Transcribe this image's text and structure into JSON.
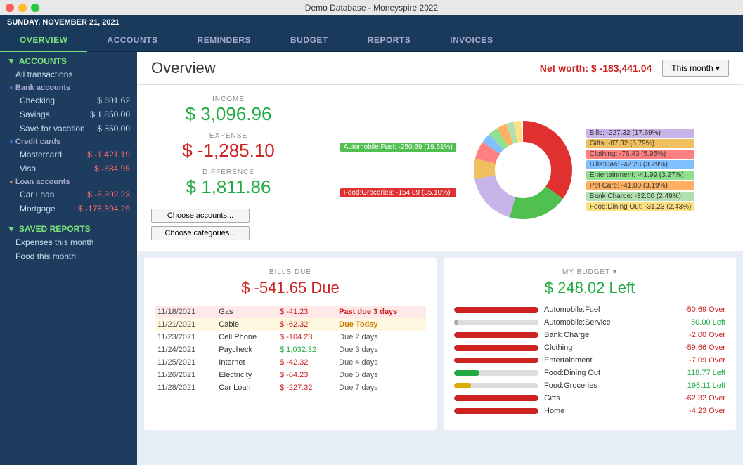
{
  "titlebar": {
    "title": "Demo Database - Moneyspire 2022"
  },
  "datebar": {
    "date": "SUNDAY, NOVEMBER 21, 2021"
  },
  "navtabs": {
    "tabs": [
      {
        "id": "overview",
        "label": "OVERVIEW",
        "active": true
      },
      {
        "id": "accounts",
        "label": "ACCOUNTS",
        "active": false
      },
      {
        "id": "reminders",
        "label": "REMINDERS",
        "active": false
      },
      {
        "id": "budget",
        "label": "BUDGET",
        "active": false
      },
      {
        "id": "reports",
        "label": "REPORTS",
        "active": false
      },
      {
        "id": "invoices",
        "label": "INVOICES",
        "active": false
      }
    ]
  },
  "sidebar": {
    "accounts_label": "ACCOUNTS",
    "all_transactions_label": "All transactions",
    "bank_accounts_label": "Bank accounts",
    "bank_items": [
      {
        "name": "Checking",
        "amount": "$ 601.62",
        "neg": false
      },
      {
        "name": "Savings",
        "amount": "$ 1,850.00",
        "neg": false
      },
      {
        "name": "Save for vacation",
        "amount": "$ 350.00",
        "neg": false
      }
    ],
    "credit_cards_label": "Credit cards",
    "credit_items": [
      {
        "name": "Mastercard",
        "amount": "$ -1,421.19",
        "neg": true
      },
      {
        "name": "Visa",
        "amount": "$ -684.95",
        "neg": true
      }
    ],
    "loan_accounts_label": "Loan accounts",
    "loan_items": [
      {
        "name": "Car Loan",
        "amount": "$ -5,392.23",
        "neg": true
      },
      {
        "name": "Mortgage",
        "amount": "$ -178,394.29",
        "neg": true
      }
    ],
    "saved_reports_label": "SAVED REPORTS",
    "saved_report_items": [
      {
        "name": "Expenses this month"
      },
      {
        "name": "Food this month"
      }
    ]
  },
  "overview": {
    "title": "Overview",
    "net_worth_label": "Net worth: $ -183,441.04",
    "this_month_label": "This month ▾",
    "income_label": "INCOME",
    "income_value": "$ 3,096.96",
    "expense_label": "EXPENSE",
    "expense_value": "$ -1,285.10",
    "difference_label": "DIFFERENCE",
    "difference_value": "$ 1,811.86",
    "choose_accounts_label": "Choose accounts...",
    "choose_categories_label": "Choose categories...",
    "chart_labels": [
      {
        "text": "Bills: -227.32 (17.69%)",
        "color": "#c8b4e8"
      },
      {
        "text": "Gifts: -87.32 (6.79%)",
        "color": "#f0c060"
      },
      {
        "text": "Clothing: -76.43 (5.95%)",
        "color": "#ff8080"
      },
      {
        "text": "Bills:Gas: -42.23 (3.29%)",
        "color": "#80c0ff"
      },
      {
        "text": "Entertainment: -41.99 (3.27%)",
        "color": "#90e090"
      },
      {
        "text": "Pet Care: -41.00 (3.19%)",
        "color": "#ffb060"
      },
      {
        "text": "Bank Charge: -32.00 (2.49%)",
        "color": "#b0e0b0"
      },
      {
        "text": "Food:Dining Out: -31.23 (2.43%)",
        "color": "#ffe080"
      }
    ],
    "pie_segments": [
      {
        "label": "Food:Groceries",
        "value": 35.1,
        "color": "#e03030",
        "startAngle": 0
      },
      {
        "label": "Automobile:Fuel",
        "value": 19.51,
        "color": "#50c050",
        "startAngle": 126.36
      },
      {
        "label": "Bills",
        "value": 17.69,
        "color": "#c8b4e8",
        "startAngle": 196.72
      },
      {
        "label": "Gifts",
        "value": 6.79,
        "color": "#f0c060",
        "startAngle": 260.5
      },
      {
        "label": "Clothing",
        "value": 5.95,
        "color": "#ff8080",
        "startAngle": 284.94
      },
      {
        "label": "Bills:Gas",
        "value": 3.29,
        "color": "#80c0ff",
        "startAngle": 306.36
      },
      {
        "label": "Entertainment",
        "value": 3.27,
        "color": "#90e090",
        "startAngle": 318.2
      },
      {
        "label": "Pet Care",
        "value": 3.19,
        "color": "#ffb060",
        "startAngle": 329.97
      },
      {
        "label": "Bank Charge",
        "value": 2.49,
        "color": "#b0e0b0",
        "startAngle": 341.47
      },
      {
        "label": "Food:Dining Out",
        "value": 2.43,
        "color": "#ffe080",
        "startAngle": 350.42
      }
    ],
    "chart_food_label": "Food:Groceries: -154.89 (35.10%)",
    "chart_auto_label": "Automobile:Fuel: -250.69 (19.51%)"
  },
  "bills": {
    "subtitle": "BILLS DUE",
    "amount": "$ -541.65 Due",
    "rows": [
      {
        "date": "11/18/2021",
        "name": "Gas",
        "amount": "$ -41.23",
        "status": "Past due 3 days",
        "style": "red"
      },
      {
        "date": "11/21/2021",
        "name": "Cable",
        "amount": "$ -62.32",
        "status": "Due Today",
        "style": "yellow"
      },
      {
        "date": "11/23/2021",
        "name": "Cell Phone",
        "amount": "$ -104.23",
        "status": "Due 2 days",
        "style": "normal"
      },
      {
        "date": "11/24/2021",
        "name": "Paycheck",
        "amount": "$ 1,032.32",
        "status": "Due 3 days",
        "style": "normal"
      },
      {
        "date": "11/25/2021",
        "name": "Internet",
        "amount": "$ -42.32",
        "status": "Due 4 days",
        "style": "normal"
      },
      {
        "date": "11/26/2021",
        "name": "Electricity",
        "amount": "$ -64.23",
        "status": "Due 5 days",
        "style": "normal"
      },
      {
        "date": "11/28/2021",
        "name": "Car Loan",
        "amount": "$ -227.32",
        "status": "Due 7 days",
        "style": "normal"
      }
    ]
  },
  "budget": {
    "subtitle": "MY BUDGET ▾",
    "amount": "$ 248.02 Left",
    "rows": [
      {
        "name": "Automobile:Fuel",
        "value": -50.69,
        "label": "-50.69 Over",
        "fill": 100,
        "type": "red"
      },
      {
        "name": "Automobile:Service",
        "value": 50.0,
        "label": "50.00 Left",
        "fill": 5,
        "type": "gray"
      },
      {
        "name": "Bank Charge",
        "value": -2.0,
        "label": "-2.00 Over",
        "fill": 100,
        "type": "red"
      },
      {
        "name": "Clothing",
        "value": -59.66,
        "label": "-59.66 Over",
        "fill": 100,
        "type": "red"
      },
      {
        "name": "Entertainment",
        "value": -7.09,
        "label": "-7.09 Over",
        "fill": 100,
        "type": "red"
      },
      {
        "name": "Food:Dining Out",
        "value": 118.77,
        "label": "118.77 Left",
        "fill": 30,
        "type": "green"
      },
      {
        "name": "Food:Groceries",
        "value": 195.11,
        "label": "195.11 Left",
        "fill": 20,
        "type": "yellow"
      },
      {
        "name": "Gifts",
        "value": -62.32,
        "label": "-62.32 Over",
        "fill": 100,
        "type": "red"
      },
      {
        "name": "Home",
        "value": -4.23,
        "label": "-4.23 Over",
        "fill": 100,
        "type": "red"
      }
    ]
  }
}
